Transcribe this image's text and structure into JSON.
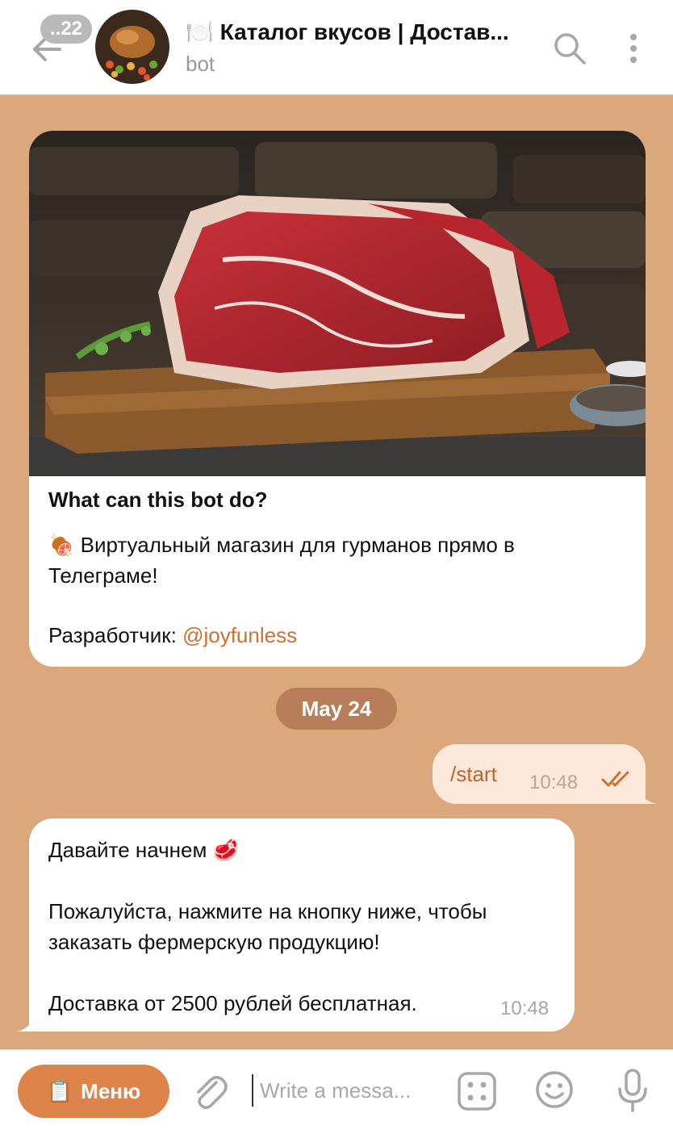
{
  "header": {
    "unread_badge": "..22",
    "chat_title": "🍽️ Каталог вкусов | Достав...",
    "chat_subtitle": "bot"
  },
  "intro_card": {
    "heading": "What can this bot do?",
    "description": "🍖 Виртуальный магазин для гурманов прямо в Телеграме!",
    "developer_label": "Разработчик: ",
    "developer_link": "@joyfunless"
  },
  "date_divider": "May 24",
  "messages": [
    {
      "direction": "outgoing",
      "text": "/start",
      "time": "10:48",
      "status": "read"
    },
    {
      "direction": "incoming",
      "lines": [
        "Давайте начнем 🥩",
        "Пожалуйста, нажмите на кнопку ниже, чтобы",
        "заказать фермерскую продукцию!",
        "Доставка от 2500 рублей бесплатная."
      ],
      "time": "10:48"
    }
  ],
  "composer": {
    "menu_icon": "📋",
    "menu_label": "Меню",
    "placeholder": "Write a messa..."
  },
  "colors": {
    "chat_background": "#dba77c",
    "accent": "#dd844b",
    "link": "#d0702e",
    "outgoing_bubble": "#fde9db",
    "date_chip": "#b87e59"
  }
}
